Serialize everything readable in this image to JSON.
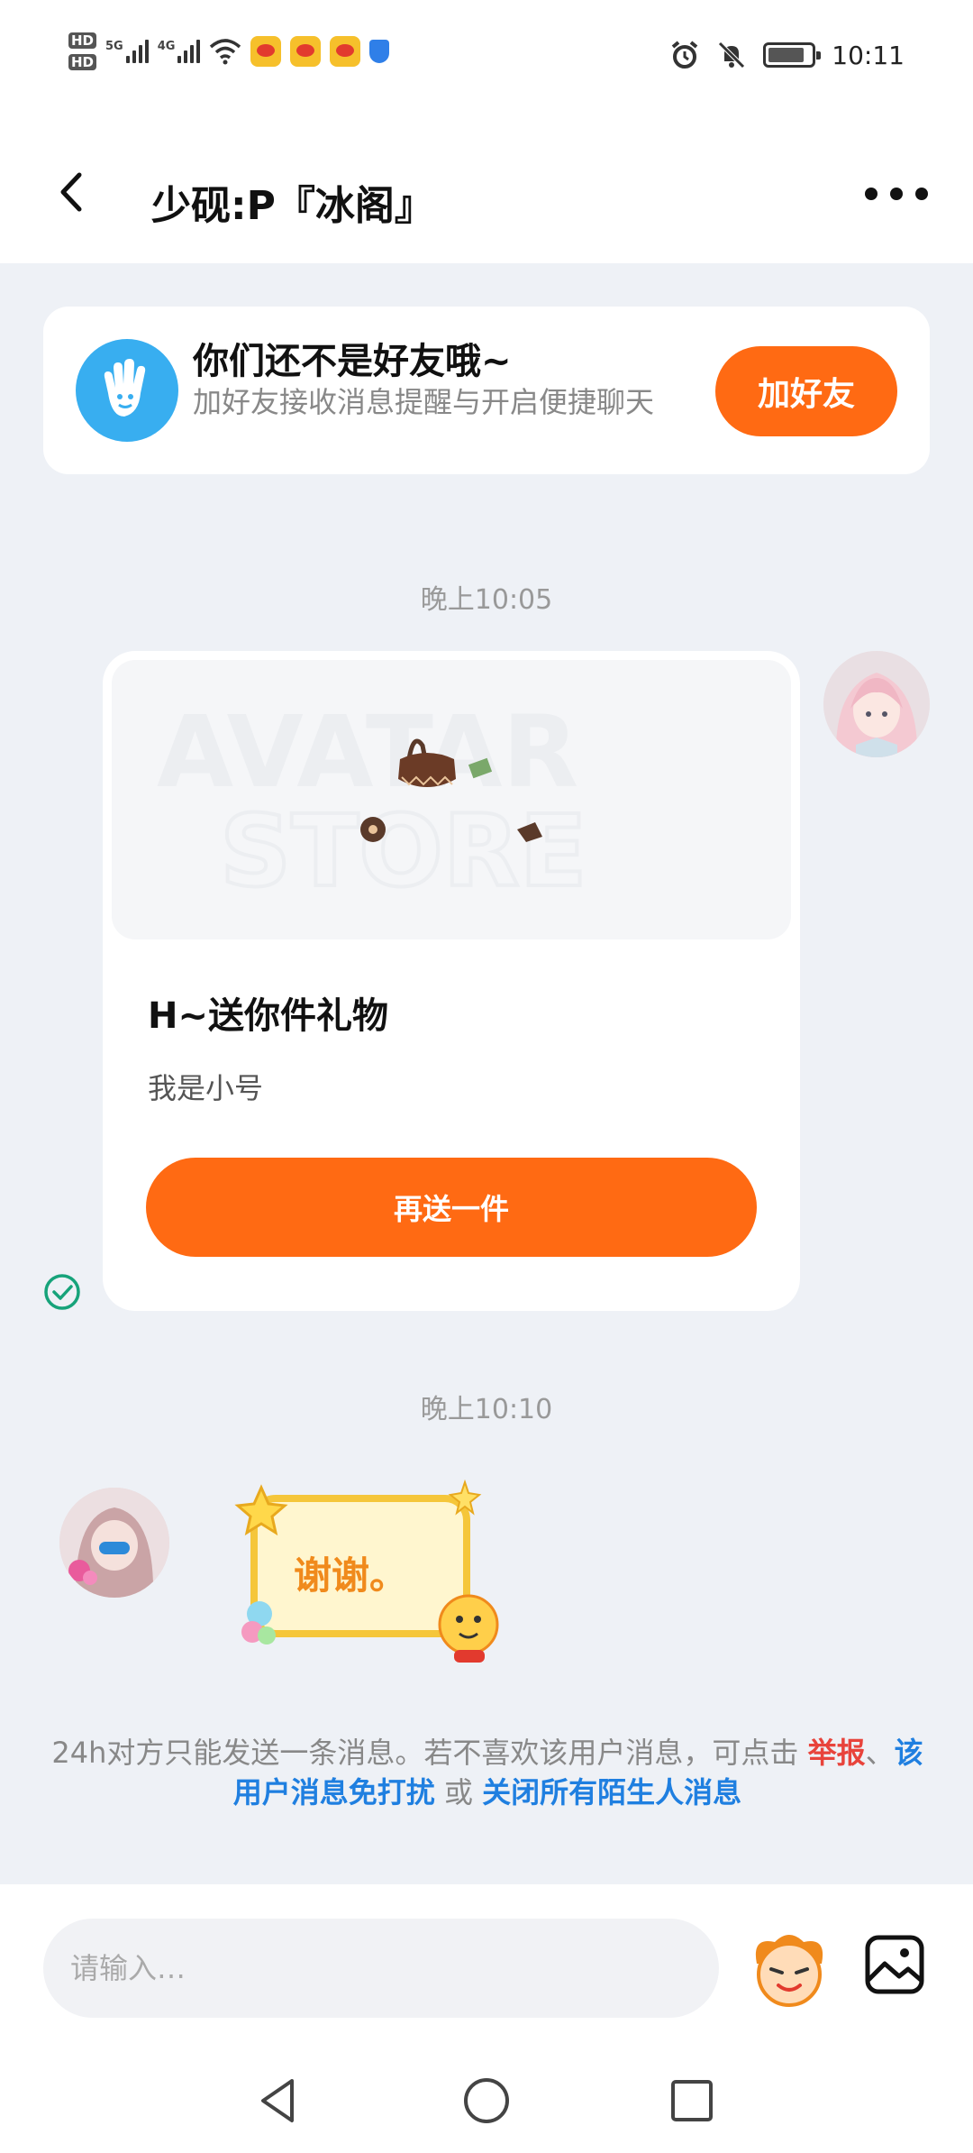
{
  "status_bar": {
    "hd_badges": [
      "HD",
      "HD"
    ],
    "network_labels": [
      "5G",
      "4G"
    ],
    "time": "10:11",
    "battery_level": 0.85
  },
  "header": {
    "title": "少砚:P『冰阁』",
    "back_icon": "chevron-left-icon",
    "more_icon": "more-horizontal-icon"
  },
  "friend_banner": {
    "title": "你们还不是好友哦~",
    "subtitle": "加好友接收消息提醒与开启便捷聊天",
    "button_label": "加好友",
    "icon": "hand-wave-icon"
  },
  "messages": {
    "time1": "晚上10:05",
    "gift": {
      "title": "H~送你件礼物",
      "note": "我是小号",
      "button_label": "再送一件",
      "status_icon": "sent-check-icon"
    },
    "time2": "晚上10:10",
    "sticker_text": "谢谢。"
  },
  "notice": {
    "prefix": "24h对方只能发送一条消息。若不喜欢该用户消息，可点击",
    "report": "举报",
    "sep1": "、",
    "mute": "该用户消息免打扰",
    "sep2": "或",
    "close_all": "关闭所有陌生人消息"
  },
  "input": {
    "placeholder": "请输入…"
  },
  "colors": {
    "accent": "#ff6a13",
    "link": "#1f7fe0",
    "danger": "#e8433b",
    "background": "#eef1f6"
  }
}
